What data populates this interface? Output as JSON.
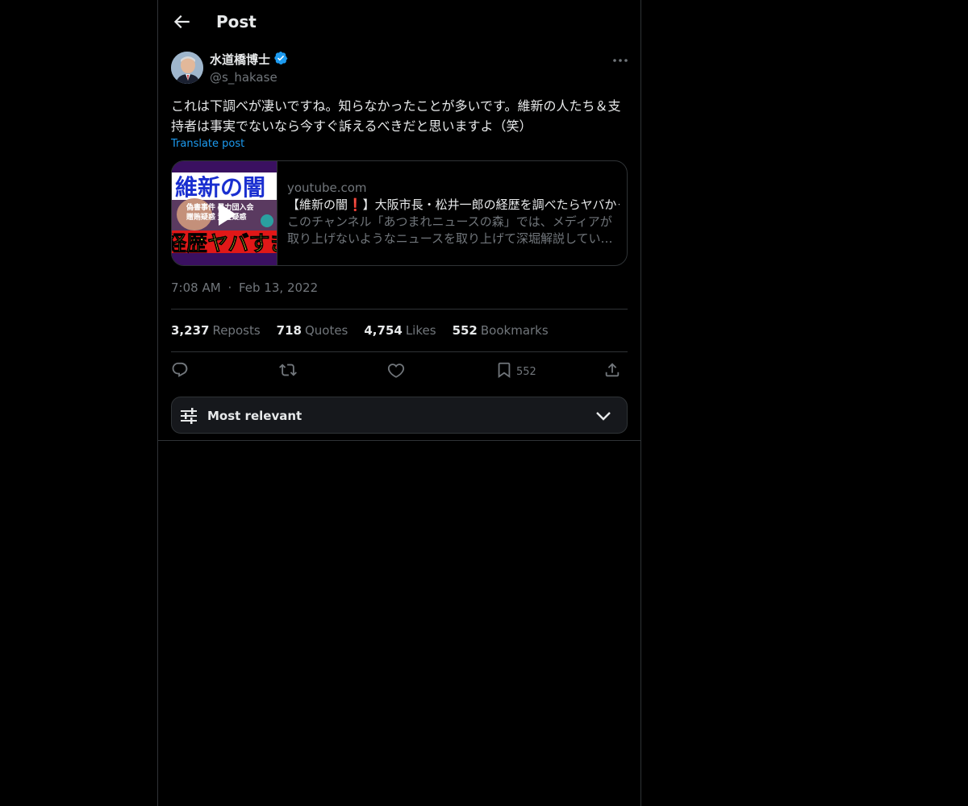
{
  "header": {
    "title": "Post"
  },
  "author": {
    "name": "水道橋博士",
    "handle": "@s_hakase",
    "verified": true
  },
  "post": {
    "text": "これは下調べが凄いですね。知らなかったことが多いです。維新の人たち＆支持者は事実でないなら今すぐ訴えるべきだと思いますよ（笑）",
    "translate_label": "Translate post",
    "timestamp_time": "7:08 AM",
    "timestamp_sep": "·",
    "timestamp_date": "Feb 13, 2022"
  },
  "card": {
    "domain": "youtube.com",
    "title": "【維新の闇❗】大阪市長・松井一郎の経歴を調べたらヤバかった…",
    "description": "このチャンネル「あつまれニュースの森」では、メディアが取り上げないようなニュースを取り上げて深堀解説しています。",
    "thumb_top_text": "維新の闇",
    "thumb_mid_text1": "偽書事件 暴力団入会",
    "thumb_mid_text2": "贈賄疑惑 資金疑惑",
    "thumb_bottom_text": "経歴ヤバすぎ"
  },
  "stats": [
    {
      "num": "3,237",
      "label": "Reposts"
    },
    {
      "num": "718",
      "label": "Quotes"
    },
    {
      "num": "4,754",
      "label": "Likes"
    },
    {
      "num": "552",
      "label": "Bookmarks"
    }
  ],
  "actions": {
    "bookmark_count": "552"
  },
  "sort": {
    "label": "Most relevant"
  },
  "colors": {
    "background": "#000000",
    "text": "#e7e9ea",
    "muted": "#71767b",
    "accent": "#1d9bf0",
    "border": "#2f3336"
  }
}
